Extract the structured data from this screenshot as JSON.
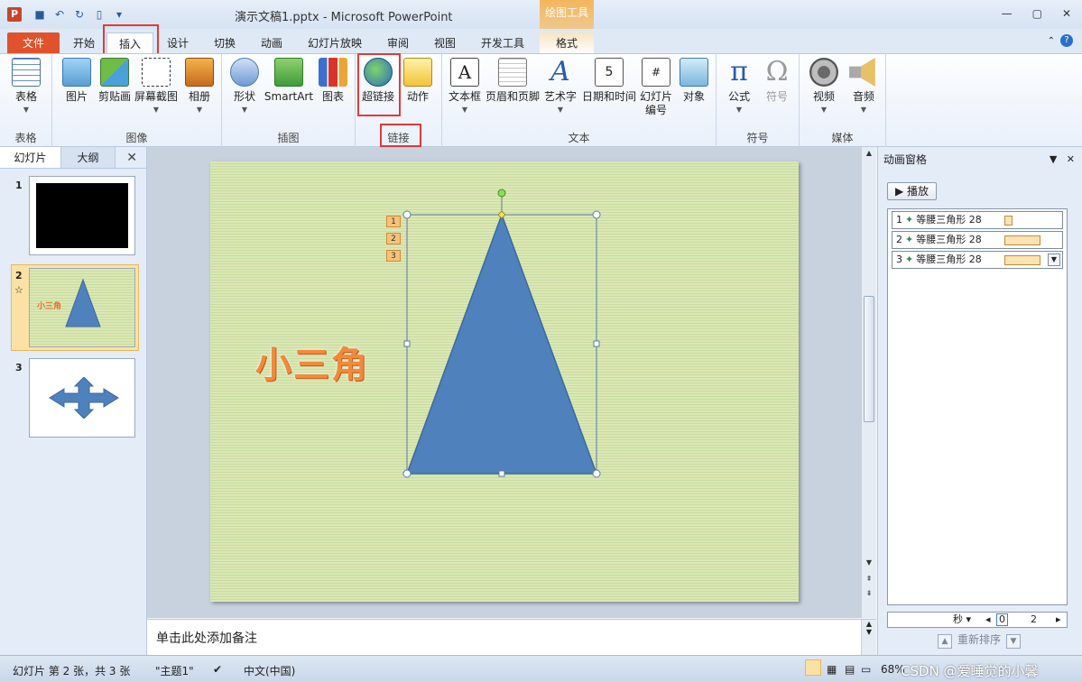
{
  "titlebar": {
    "app_icon": "P",
    "window_title": "演示文稿1.pptx - Microsoft PowerPoint",
    "context_tab": "绘图工具"
  },
  "tabs": [
    "文件",
    "开始",
    "插入",
    "设计",
    "切换",
    "动画",
    "幻灯片放映",
    "审阅",
    "视图",
    "开发工具",
    "格式"
  ],
  "ribbon": {
    "groups": {
      "tables": "表格",
      "images": "图像",
      "illustrations": "插图",
      "links": "链接",
      "text": "文本",
      "symbols": "符号",
      "media": "媒体"
    },
    "buttons": {
      "table": "表格",
      "picture": "图片",
      "clipart": "剪贴画",
      "screenshot": "屏幕截图",
      "album": "相册",
      "shapes": "形状",
      "smartart": "SmartArt",
      "chart": "图表",
      "hyperlink": "超链接",
      "action": "动作",
      "textbox": "文本框",
      "header_footer": "页眉和页脚",
      "wordart": "艺术字",
      "datetime": "日期和时间",
      "slide_number_1": "幻灯片",
      "slide_number_2": "编号",
      "object": "对象",
      "equation": "公式",
      "symbol": "符号",
      "video": "视频",
      "audio": "音频"
    },
    "date_icon_digit": "5",
    "slide_number_icon": "#",
    "textbox_icon_letter": "A",
    "wordart_icon_letter": "A"
  },
  "left_panel": {
    "tab_slides": "幻灯片",
    "tab_outline": "大纲",
    "slides": [
      {
        "number": "1"
      },
      {
        "number": "2",
        "thumb_title": "小三角"
      },
      {
        "number": "3"
      }
    ]
  },
  "slide": {
    "title": "小三角",
    "animation_tags": [
      "1",
      "2",
      "3"
    ]
  },
  "notes": {
    "placeholder": "单击此处添加备注"
  },
  "animation_pane": {
    "title": "动画窗格",
    "play_label": "播放",
    "items": [
      {
        "index": "1",
        "name": "等腰三角形",
        "id": "28"
      },
      {
        "index": "2",
        "name": "等腰三角形",
        "id": "28"
      },
      {
        "index": "3",
        "name": "等腰三角形",
        "id": "28"
      }
    ],
    "timeline_unit": "秒",
    "timeline_start": "0",
    "timeline_end": "2",
    "reorder_label": "重新排序"
  },
  "statusbar": {
    "slide_info": "幻灯片 第 2 张，共 3 张",
    "theme": "\"主题1\"",
    "language": "中文(中国)",
    "zoom": "68%",
    "watermark": "CSDN @爱睡觉的小馨"
  },
  "colors": {
    "file_tab": "#e0522c",
    "highlight_box": "#e03a3a",
    "triangle_fill": "#4f81bd",
    "title_text": "#f08a3c",
    "slide_background": "#dbe7b4"
  }
}
